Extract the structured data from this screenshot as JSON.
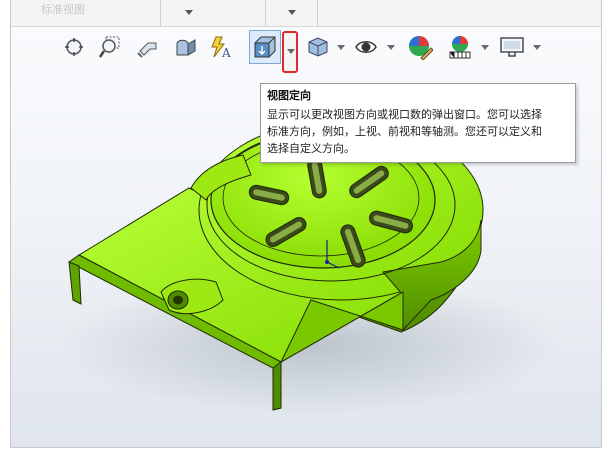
{
  "toolbar": {
    "buttons": [
      {
        "name": "zoom-to-fit-icon"
      },
      {
        "name": "zoom-to-area-icon"
      },
      {
        "name": "previous-view-icon"
      },
      {
        "name": "section-view-icon"
      },
      {
        "name": "dynamic-annotation-icon"
      },
      {
        "name": "view-orientation-icon"
      },
      {
        "name": "display-style-icon"
      },
      {
        "name": "hide-show-items-icon"
      },
      {
        "name": "edit-appearance-icon"
      },
      {
        "name": "apply-scene-icon"
      },
      {
        "name": "view-settings-icon"
      }
    ]
  },
  "tooltip": {
    "title": "视图定向",
    "lines": [
      "显示可以更改视图方向或视口数的弹出窗口。您可以选择",
      "标准方向，例如，上视、前视和等轴测。您还可以定义和",
      "选择自定义方向。"
    ]
  },
  "topstrip": {
    "faded_text": "标准视图"
  },
  "colors": {
    "model_green": "#8ee400",
    "model_edge": "#1f2a00",
    "highlight_red": "#e02a2a",
    "active_blue": "#7aa7d8"
  }
}
